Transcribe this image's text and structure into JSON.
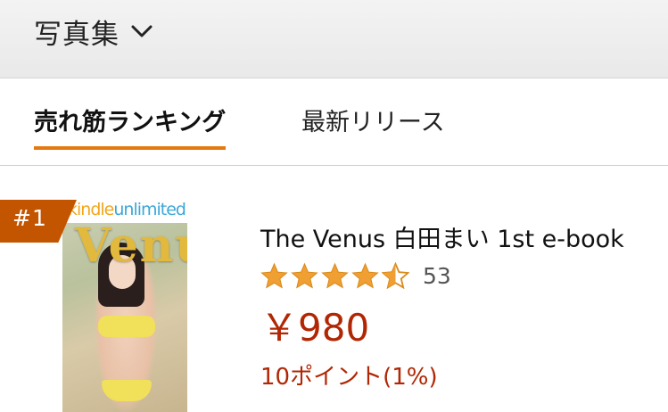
{
  "header": {
    "category_label": "写真集",
    "chevron_icon": "chevron-down-icon"
  },
  "tabs": [
    {
      "label": "売れ筋ランキング",
      "active": true
    },
    {
      "label": "最新リリース",
      "active": false
    }
  ],
  "item": {
    "rank": "#1",
    "cover": {
      "banner_kindle": "kindle",
      "banner_unlimited": "unlimited",
      "title_text": "Venus"
    },
    "title": "The Venus 白田まい 1st e-book",
    "rating": {
      "stars": 4.5,
      "count": "53"
    },
    "price": "￥980",
    "points": "10ポイント(1%)"
  },
  "colors": {
    "accent_orange": "#e47911",
    "rank_badge": "#c45500",
    "price_red": "#b12704",
    "star_gold": "#f0a033"
  }
}
